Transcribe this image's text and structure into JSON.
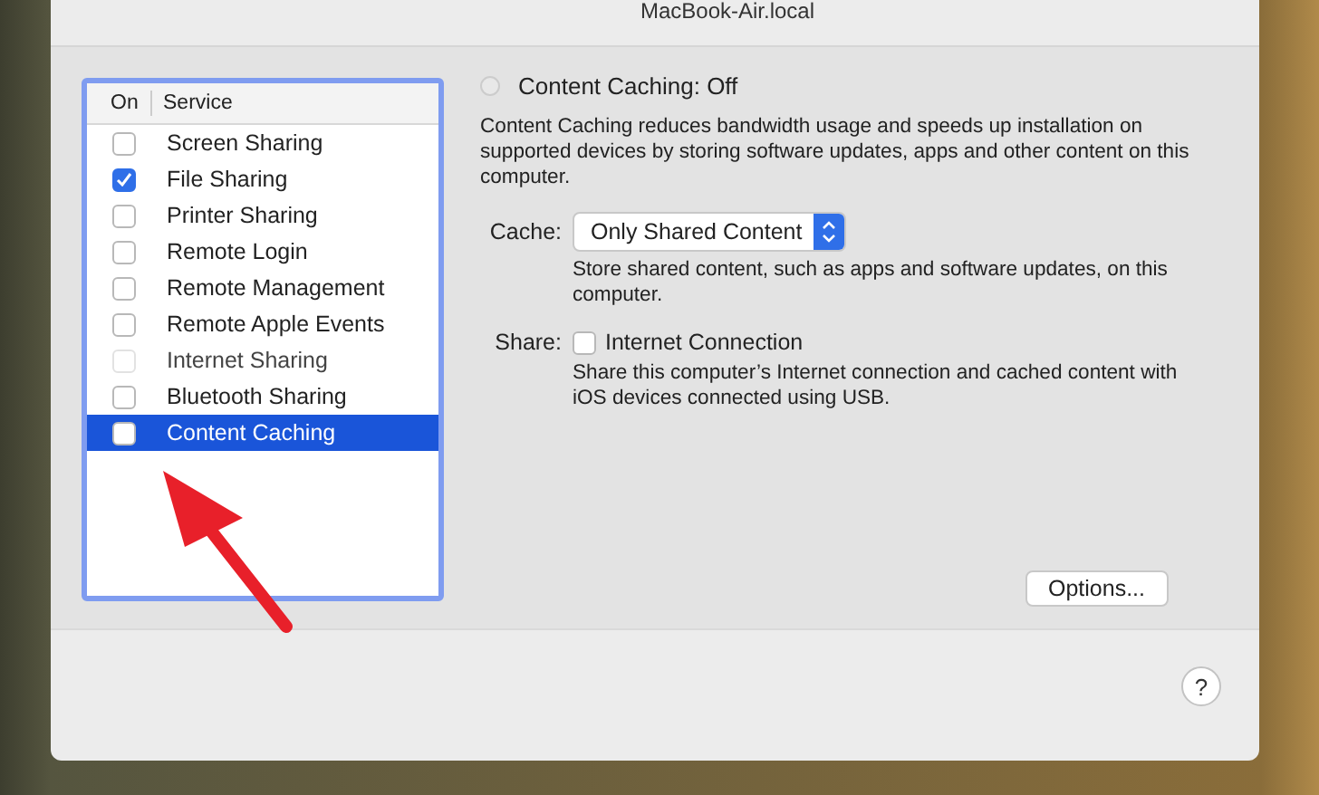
{
  "computer_name": "MacBook-Air.local",
  "services_table": {
    "columns": [
      "On",
      "Service"
    ],
    "rows": [
      {
        "name": "Screen Sharing",
        "checked": false,
        "disabled": false,
        "selected": false
      },
      {
        "name": "File Sharing",
        "checked": true,
        "disabled": false,
        "selected": false
      },
      {
        "name": "Printer Sharing",
        "checked": false,
        "disabled": false,
        "selected": false
      },
      {
        "name": "Remote Login",
        "checked": false,
        "disabled": false,
        "selected": false
      },
      {
        "name": "Remote Management",
        "checked": false,
        "disabled": false,
        "selected": false
      },
      {
        "name": "Remote Apple Events",
        "checked": false,
        "disabled": false,
        "selected": false
      },
      {
        "name": "Internet Sharing",
        "checked": false,
        "disabled": true,
        "selected": false
      },
      {
        "name": "Bluetooth Sharing",
        "checked": false,
        "disabled": false,
        "selected": false
      },
      {
        "name": "Content Caching",
        "checked": false,
        "disabled": false,
        "selected": true
      }
    ]
  },
  "detail": {
    "status": "Content Caching: Off",
    "status_on": false,
    "description": "Content Caching reduces bandwidth usage and speeds up installation on supported devices by storing software updates, apps and other content on this computer.",
    "cache_label": "Cache:",
    "cache_value": "Only Shared Content",
    "cache_hint": "Store shared content, such as apps and software updates, on this computer.",
    "share_label": "Share:",
    "share_option": "Internet Connection",
    "share_checked": false,
    "share_hint": "Share this computer’s Internet connection and cached content with iOS devices connected using USB.",
    "options_button": "Options..."
  },
  "help_button": "?"
}
